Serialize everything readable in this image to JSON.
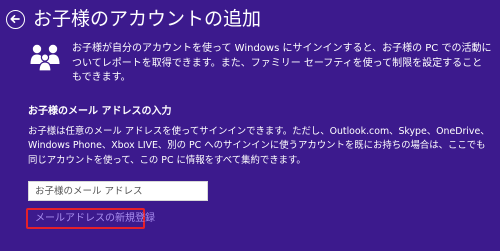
{
  "header": {
    "title": "お子様のアカウントの追加",
    "back_icon": "back-arrow-icon"
  },
  "intro": {
    "icon": "family-icon",
    "text": "お子様が自分のアカウントを使って Windows にサインインすると、お子様の PC での活動についてレポートを取得できます。また、ファミリー セーフティを使って制限を設定することもできます。"
  },
  "email_section": {
    "heading": "お子様のメール アドレスの入力",
    "description": "お子様は任意のメール アドレスを使ってサインインできます。ただし、Outlook.com、Skype、OneDrive、Windows Phone、Xbox LIVE、別の PC へのサインインに使うアカウントを既にお持ちの場合は、ここでも同じアカウントを使って、この PC に情報をすべて集約できます。",
    "email_placeholder": "お子様のメール アドレス",
    "register_link": "メールアドレスの新規登録"
  },
  "colors": {
    "background": "#3c1a8d",
    "link": "#a98ef0",
    "highlight_box": "#e5202a"
  }
}
